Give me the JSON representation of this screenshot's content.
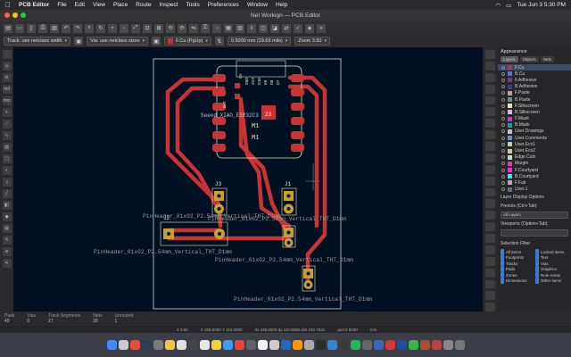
{
  "menubar": {
    "app_name": "PCB Editor",
    "items": [
      "File",
      "Edit",
      "View",
      "Place",
      "Route",
      "Inspect",
      "Tools",
      "Preferences",
      "Window",
      "Help"
    ],
    "clock": "Tue Jun 3  5:30 PM"
  },
  "window": {
    "title": "Net Workign — PCB Editor"
  },
  "toolbar": {
    "track": "Track: use netclass width",
    "via": "Via: use netclass sizes",
    "layer": "F.Cu (PgUp)",
    "layer_color": "#c83434",
    "grid": "0.5000 mm (19.69 mils)",
    "zoom": "Zoom 3.50"
  },
  "appearance": {
    "title": "Appearance",
    "tabs": [
      "Layers",
      "Objects",
      "Nets"
    ],
    "layers": [
      {
        "name": "F.Cu",
        "color": "#c83434"
      },
      {
        "name": "B.Cu",
        "color": "#4d7fc4"
      },
      {
        "name": "F.Adhesive",
        "color": "#8a2f8a"
      },
      {
        "name": "B.Adhesive",
        "color": "#3d3d8f"
      },
      {
        "name": "F.Paste",
        "color": "#b3a6a6"
      },
      {
        "name": "B.Paste",
        "color": "#5c9a8f"
      },
      {
        "name": "F.Silkscreen",
        "color": "#e8e8b0"
      },
      {
        "name": "B.Silkscreen",
        "color": "#e0b0ff"
      },
      {
        "name": "F.Mask",
        "color": "#cc33cc"
      },
      {
        "name": "B.Mask",
        "color": "#1a9a99"
      },
      {
        "name": "User.Drawings",
        "color": "#c2c2c2"
      },
      {
        "name": "User.Comments",
        "color": "#6d8ed4"
      },
      {
        "name": "User.Eco1",
        "color": "#b4d4a4"
      },
      {
        "name": "User.Eco2",
        "color": "#d8c888"
      },
      {
        "name": "Edge.Cuts",
        "color": "#d0d2cd"
      },
      {
        "name": "Margin",
        "color": "#ff26e2"
      },
      {
        "name": "F.Courtyard",
        "color": "#ff26e2"
      },
      {
        "name": "B.Courtyard",
        "color": "#26e9ff"
      },
      {
        "name": "F.Fab",
        "color": "#afafaf"
      },
      {
        "name": "User.1",
        "color": "#586f8c"
      }
    ],
    "layer_display_options": "Layer Display Options",
    "presets_label": "Presets (Ctrl+Tab):",
    "presets_value": "All Layers",
    "viewports_label": "Viewports (Option+Tab):",
    "selection_filter": "Selection Filter",
    "filters": [
      "All items",
      "Locked items",
      "Footprints",
      "Text",
      "Tracks",
      "Vias",
      "Pads",
      "Graphics",
      "Zones",
      "Rule Areas",
      "Dimensions",
      "Other items"
    ]
  },
  "board": {
    "u1_ref": "Seeed_XIAO_ESP32C3",
    "u1_pins": [
      "5V",
      "GND",
      "3V3",
      "D10",
      "D9",
      "D8",
      "D7"
    ],
    "u1_bat": "BAT",
    "m1_a": "M1",
    "m1_b": "M1",
    "pad_label": "23",
    "j3": "J3",
    "j1": "J1",
    "j2": "J2",
    "fp_value_1": "PinHeader_01x02_P2.54mm_Vertical_THT_D1mm",
    "fp_value_2": "PinHeader_01x02_P2.54mm_Vertical_THT_D1mm",
    "fp_value_3": "PinHeader_01x02_P2.54mm_Vertical_THT_D1mm",
    "fp_value_4": "PinHeader_01x02_P2.54mm_Vertical_THT_D1mm",
    "fp_value_5": "PinHeader_01x02_P2.54mm_Vertical_THT_D1mm"
  },
  "status": {
    "pads_label": "Pads",
    "pads": "49",
    "vias_label": "Vias",
    "vias": "0",
    "tracks_label": "Track Segments",
    "tracks": "27",
    "nets_label": "Nets",
    "nets": "28",
    "unrouted_label": "Unrouted",
    "unrouted": "1"
  },
  "coords": {
    "z": "Z 3.50",
    "xy": "X 159.5000  Y 110.0000",
    "dxdy": "dx 159.5000  dy 110.0000  dist 193.7631",
    "grid": "grid 0.5000",
    "unit": "mm"
  }
}
